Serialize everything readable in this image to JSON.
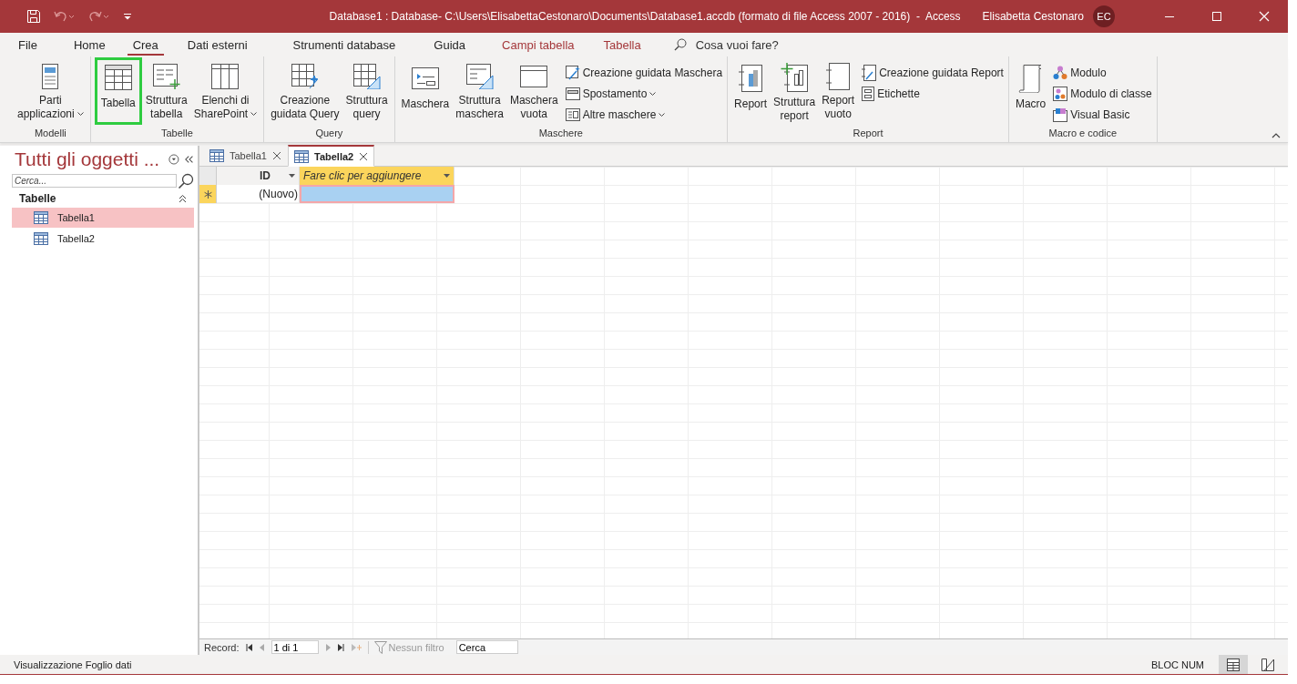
{
  "window": {
    "title": "Database1 : Database- C:\\Users\\ElisabettaCestonaro\\Documents\\Database1.accdb (formato di file Access 2007 - 2016)  -  Access",
    "user": "Elisabetta Cestonaro",
    "avatar": "EC"
  },
  "menu_tabs": [
    {
      "label": "File",
      "selected": false,
      "contextual": false
    },
    {
      "label": "Home",
      "selected": false,
      "contextual": false
    },
    {
      "label": "Crea",
      "selected": true,
      "contextual": false
    },
    {
      "label": "Dati esterni",
      "selected": false,
      "contextual": false
    },
    {
      "label": "Strumenti database",
      "selected": false,
      "contextual": false
    },
    {
      "label": "Guida",
      "selected": false,
      "contextual": false
    },
    {
      "label": "Campi tabella",
      "selected": false,
      "contextual": true
    },
    {
      "label": "Tabella",
      "selected": false,
      "contextual": true
    }
  ],
  "tell_me": {
    "placeholder": "Cosa vuoi fare?"
  },
  "ribbon": {
    "groups": [
      {
        "label": "Modelli",
        "buttons": [
          {
            "kind": "large",
            "label": "Parti\napplicazioni",
            "dropdown": true,
            "highlighted": false
          }
        ]
      },
      {
        "label": "Tabelle",
        "buttons": [
          {
            "kind": "large",
            "label": "Tabella",
            "dropdown": false,
            "highlighted": true
          },
          {
            "kind": "large",
            "label": "Struttura\ntabella",
            "dropdown": false,
            "highlighted": false
          },
          {
            "kind": "large",
            "label": "Elenchi di\nSharePoint",
            "dropdown": true,
            "highlighted": false
          }
        ]
      },
      {
        "label": "Query",
        "buttons": [
          {
            "kind": "large",
            "label": "Creazione\nguidata Query",
            "dropdown": false,
            "highlighted": false
          },
          {
            "kind": "large",
            "label": "Struttura\nquery",
            "dropdown": false,
            "highlighted": false
          }
        ]
      },
      {
        "label": "Maschere",
        "buttons": [
          {
            "kind": "large",
            "label": "Maschera",
            "dropdown": false,
            "highlighted": false
          },
          {
            "kind": "large",
            "label": "Struttura\nmaschera",
            "dropdown": false,
            "highlighted": false
          },
          {
            "kind": "large",
            "label": "Maschera\nvuota",
            "dropdown": false,
            "highlighted": false
          },
          {
            "kind": "small",
            "label": "Creazione guidata Maschera",
            "dropdown": false,
            "highlighted": false
          },
          {
            "kind": "small",
            "label": "Spostamento",
            "dropdown": true,
            "highlighted": false
          },
          {
            "kind": "small",
            "label": "Altre maschere",
            "dropdown": true,
            "highlighted": false
          }
        ]
      },
      {
        "label": "Report",
        "buttons": [
          {
            "kind": "large",
            "label": "Report",
            "dropdown": false,
            "highlighted": false
          },
          {
            "kind": "large",
            "label": "Struttura\nreport",
            "dropdown": false,
            "highlighted": false
          },
          {
            "kind": "large",
            "label": "Report\nvuoto",
            "dropdown": false,
            "highlighted": false
          },
          {
            "kind": "small",
            "label": "Creazione guidata Report",
            "dropdown": false,
            "highlighted": false
          },
          {
            "kind": "small",
            "label": "Etichette",
            "dropdown": false,
            "highlighted": false
          }
        ]
      },
      {
        "label": "Macro e codice",
        "buttons": [
          {
            "kind": "large",
            "label": "Macro",
            "dropdown": false,
            "highlighted": false
          },
          {
            "kind": "small",
            "label": "Modulo",
            "dropdown": false,
            "highlighted": false
          },
          {
            "kind": "small",
            "label": "Modulo di classe",
            "dropdown": false,
            "highlighted": false
          },
          {
            "kind": "small",
            "label": "Visual Basic",
            "dropdown": false,
            "highlighted": false
          }
        ]
      }
    ]
  },
  "nav_pane": {
    "title": "Tutti gli oggetti ...",
    "search": {
      "placeholder": "Cerca..."
    },
    "group": {
      "label": "Tabelle",
      "expanded": true,
      "items": [
        {
          "label": "Tabella1",
          "selected": true
        },
        {
          "label": "Tabella2",
          "selected": false
        }
      ]
    }
  },
  "document_tabs": [
    {
      "label": "Tabella1",
      "selected": false
    },
    {
      "label": "Tabella2",
      "selected": true
    }
  ],
  "datasheet": {
    "columns": [
      {
        "kind": "field",
        "label": "ID"
      },
      {
        "kind": "add",
        "label": "Fare clic per aggiungere"
      }
    ],
    "rows": [
      {
        "new_record": true,
        "cells": [
          {
            "text": "(Nuovo)",
            "selected": false
          },
          {
            "selected": true
          }
        ]
      }
    ]
  },
  "record_nav": {
    "label": "Record:",
    "position": "1 di 1",
    "filter": {
      "label": "Nessun filtro",
      "active": false
    },
    "search": {
      "value": "Cerca"
    }
  },
  "status_bar": {
    "text": "Visualizzazione Foglio dati",
    "indicator": "BLOC NUM",
    "views": [
      {
        "kind": "datasheet",
        "selected": true
      },
      {
        "kind": "design",
        "selected": false
      }
    ]
  }
}
